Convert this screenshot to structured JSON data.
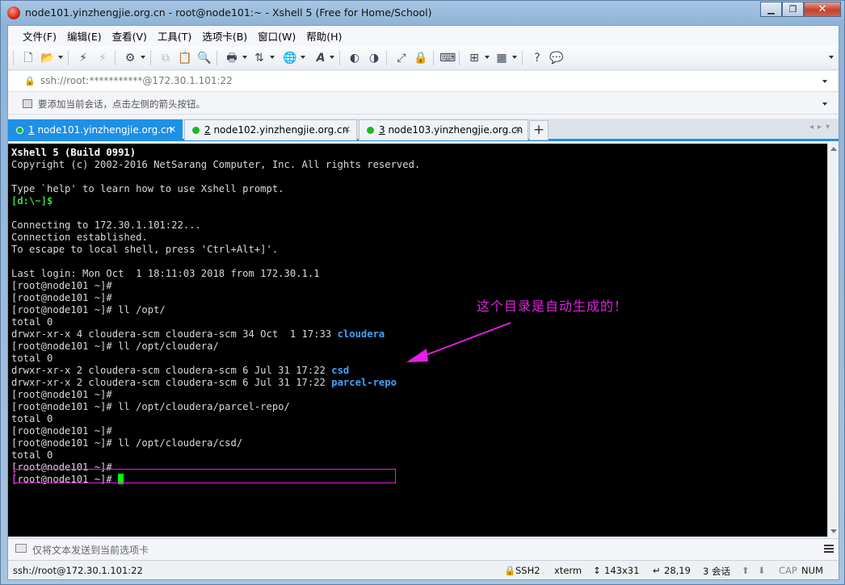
{
  "window": {
    "title": "node101.yinzhengjie.org.cn - root@node101:~ - Xshell 5 (Free for Home/School)"
  },
  "menu": [
    "文件(F)",
    "编辑(E)",
    "查看(V)",
    "工具(T)",
    "选项卡(B)",
    "窗口(W)",
    "帮助(H)"
  ],
  "address": {
    "value": "ssh://root:***********@172.30.1.101:22"
  },
  "hint": {
    "text": "要添加当前会话，点击左侧的箭头按钮。"
  },
  "tabs": [
    {
      "num": "1",
      "label": " node101.yinzhengjie.org.cn",
      "close": "✕",
      "active": true
    },
    {
      "num": "2",
      "label": " node102.yinzhengjie.org.cn",
      "close": "✕",
      "active": false
    },
    {
      "num": "3",
      "label": " node103.yinzhengjie.org.cn",
      "close": "✕",
      "active": false
    }
  ],
  "tab_add": "+",
  "terminal": {
    "lines": [
      {
        "text": "Xshell 5 (Build 0991)",
        "style": "bold"
      },
      {
        "text": "Copyright (c) 2002-2016 NetSarang Computer, Inc. All rights reserved."
      },
      {
        "text": ""
      },
      {
        "text": "Type `help' to learn how to use Xshell prompt."
      },
      {
        "text": "[d:\\~]$",
        "style": "green"
      },
      {
        "text": ""
      },
      {
        "text": "Connecting to 172.30.1.101:22..."
      },
      {
        "text": "Connection established."
      },
      {
        "text": "To escape to local shell, press 'Ctrl+Alt+]'."
      },
      {
        "text": ""
      },
      {
        "text": "Last login: Mon Oct  1 18:11:03 2018 from 172.30.1.1"
      },
      {
        "text": "[root@node101 ~]#"
      },
      {
        "text": "[root@node101 ~]#"
      },
      {
        "text": "[root@node101 ~]# ll /opt/"
      },
      {
        "text": "total 0"
      },
      {
        "text": "drwxr-xr-x 4 cloudera-scm cloudera-scm 34 Oct  1 17:33 ",
        "dir": "cloudera"
      },
      {
        "text": "[root@node101 ~]# ll /opt/cloudera/"
      },
      {
        "text": "total 0"
      },
      {
        "text": "drwxr-xr-x 2 cloudera-scm cloudera-scm 6 Jul 31 17:22 ",
        "dir": "csd"
      },
      {
        "text": "drwxr-xr-x 2 cloudera-scm cloudera-scm 6 Jul 31 17:22 ",
        "dir": "parcel-repo"
      },
      {
        "text": "[root@node101 ~]#"
      },
      {
        "text": "[root@node101 ~]# ll /opt/cloudera/parcel-repo/"
      },
      {
        "text": "total 0"
      },
      {
        "text": "[root@node101 ~]#"
      },
      {
        "text": "[root@node101 ~]# ll /opt/cloudera/csd/"
      },
      {
        "text": "total 0"
      },
      {
        "text": "[root@node101 ~]#"
      },
      {
        "text": "[root@node101 ~]# ",
        "cursor": true
      }
    ]
  },
  "annotation": {
    "text": "这个目录是自动生成的！",
    "color": "#e51fe5"
  },
  "sendbar": {
    "placeholder": "仅将文本发送到当前选项卡"
  },
  "status": {
    "connection": "ssh://root@172.30.1.101:22",
    "protocol": "SSH2",
    "term": "xterm",
    "size": "143x31",
    "cursor_pos": "28,19",
    "sessions": "3 会话",
    "cap": "CAP",
    "num": "NUM"
  },
  "colors": {
    "tab_active": "#1e90e6",
    "terminal_bg": "#000000",
    "dir_blue": "#3fa3ff",
    "prompt_green": "#3cd63c"
  }
}
